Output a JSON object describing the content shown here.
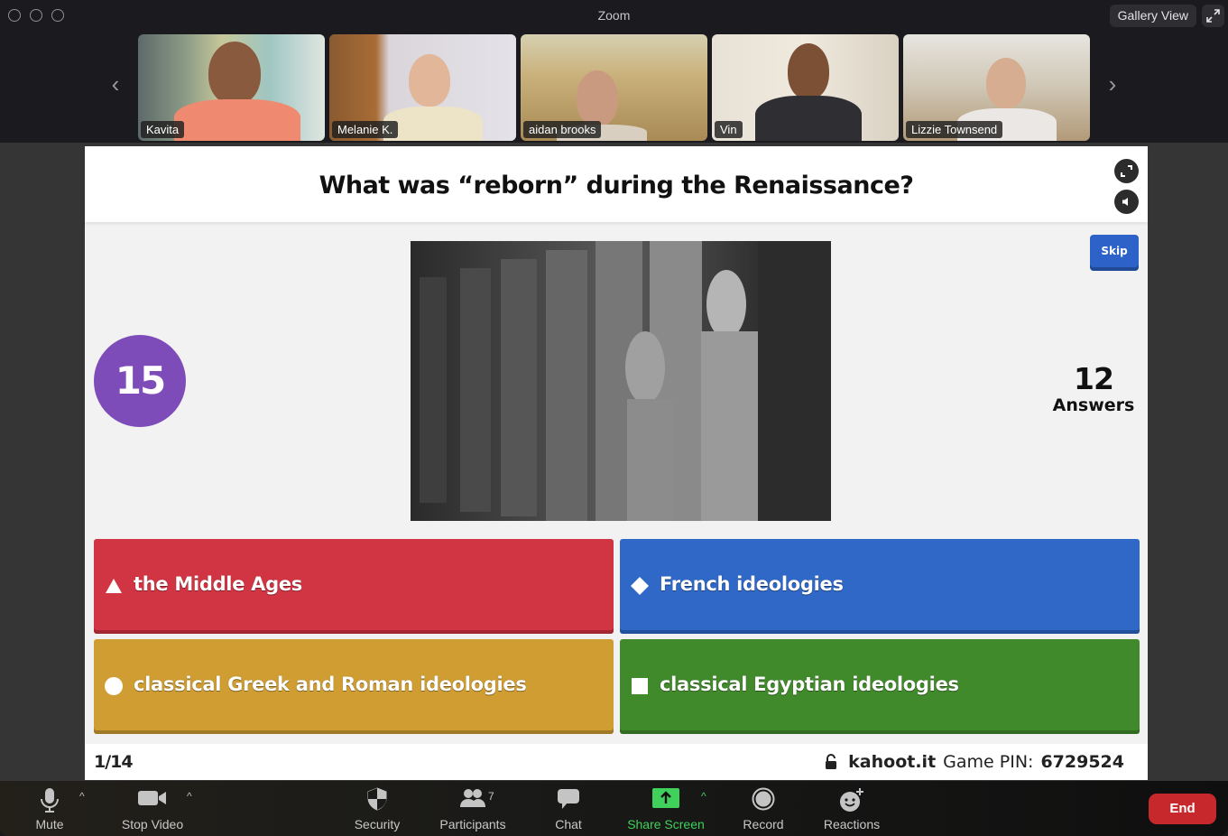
{
  "window": {
    "title": "Zoom",
    "view_mode_label": "Gallery View"
  },
  "gallery": {
    "participants": [
      {
        "name": "Kavita",
        "active_speaker": false
      },
      {
        "name": "Melanie K.",
        "active_speaker": true
      },
      {
        "name": "aidan brooks",
        "active_speaker": false
      },
      {
        "name": "Vin",
        "active_speaker": false
      },
      {
        "name": "Lizzie Townsend",
        "active_speaker": false
      }
    ],
    "prev_icon": "‹",
    "next_icon": "›"
  },
  "kahoot": {
    "question": "What was “reborn” during the Renaissance?",
    "skip_label": "Skip",
    "timer_seconds": "15",
    "answer_count": "12",
    "answer_count_label": "Answers",
    "answers": [
      {
        "shape": "triangle",
        "text": "the Middle Ages",
        "color": "#d13442"
      },
      {
        "shape": "diamond",
        "text": "French ideologies",
        "color": "#2f68c7"
      },
      {
        "shape": "circle",
        "text": "classical Greek and Roman ideologies",
        "color": "#cf9d32"
      },
      {
        "shape": "square",
        "text": "classical Egyptian ideologies",
        "color": "#418a2c"
      }
    ],
    "progress": "1/14",
    "site": "kahoot.it",
    "pin_label": "Game PIN:",
    "pin": "6729524",
    "image_description": "black-and-white photo of carved stone statues on a Renaissance building facade"
  },
  "toolbar": {
    "mute_label": "Mute",
    "stop_video_label": "Stop Video",
    "security_label": "Security",
    "participants_label": "Participants",
    "participants_count": "7",
    "chat_label": "Chat",
    "share_screen_label": "Share Screen",
    "record_label": "Record",
    "reactions_label": "Reactions",
    "end_label": "End",
    "caret": "^"
  },
  "colors": {
    "active_speaker": "#3ee05a",
    "share_green": "#3fd15b",
    "end_red": "#c6282c",
    "timer_purple": "#7e4cb8",
    "skip_blue": "#2d63c8"
  }
}
